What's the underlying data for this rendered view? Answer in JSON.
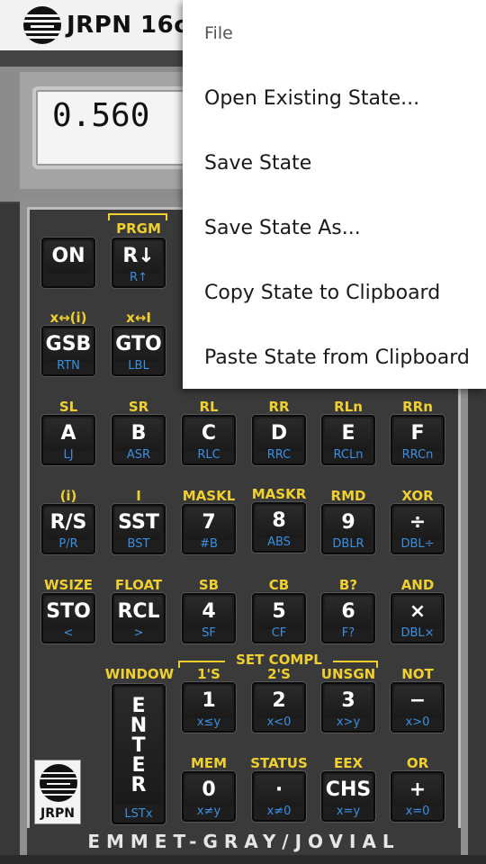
{
  "app": {
    "title": "JRPN 16c"
  },
  "display": {
    "value": "0.560"
  },
  "menu": {
    "header": "File",
    "items": [
      "Open Existing State...",
      "Save State",
      "Save State As...",
      "Copy State to Clipboard",
      "Paste State from Clipboard"
    ]
  },
  "keyboard": {
    "brand": "EMMET-GRAY/JOVIAL",
    "badge": "JRPN",
    "bracket_label": "SET COMPL",
    "top_labels": {
      "prgm": "PRGM",
      "x_swap_i": "x↔(i)",
      "x_swap_I": "x↔I",
      "sl": "SL",
      "sr": "SR",
      "rl": "RL",
      "rr": "RR",
      "rln": "RLn",
      "rrn": "RRn",
      "i_paren": "(i)",
      "i": "I",
      "maskl": "MASKL",
      "maskr": "MASKR",
      "rmd": "RMD",
      "xor": "XOR",
      "wsize": "WSIZE",
      "float": "FLOAT",
      "sb": "SB",
      "cb": "CB",
      "bq": "B?",
      "and": "AND",
      "window": "WINDOW",
      "c1s": "1'S",
      "c2s": "2'S",
      "unsgn": "UNSGN",
      "not": "NOT",
      "mem": "MEM",
      "status": "STATUS",
      "eex": "EEX",
      "or": "OR"
    },
    "keys": {
      "on": {
        "main": "ON",
        "sub": ""
      },
      "rdown": {
        "main": "R↓",
        "sub": "R↑"
      },
      "gsb": {
        "main": "GSB",
        "sub": "RTN"
      },
      "gto": {
        "main": "GTO",
        "sub": "LBL"
      },
      "a": {
        "main": "A",
        "sub": "LJ"
      },
      "b": {
        "main": "B",
        "sub": "ASR"
      },
      "c": {
        "main": "C",
        "sub": "RLC"
      },
      "d": {
        "main": "D",
        "sub": "RRC"
      },
      "e": {
        "main": "E",
        "sub": "RCLn"
      },
      "f": {
        "main": "F",
        "sub": "RRCn"
      },
      "rs": {
        "main": "R/S",
        "sub": "P/R"
      },
      "sst": {
        "main": "SST",
        "sub": "BST"
      },
      "k7": {
        "main": "7",
        "sub": "#B"
      },
      "k8": {
        "main": "8",
        "sub": "ABS"
      },
      "k9": {
        "main": "9",
        "sub": "DBLR"
      },
      "div": {
        "main": "÷",
        "sub": "DBL÷"
      },
      "sto": {
        "main": "STO",
        "sub": "<"
      },
      "rcl": {
        "main": "RCL",
        "sub": ">"
      },
      "k4": {
        "main": "4",
        "sub": "SF"
      },
      "k5": {
        "main": "5",
        "sub": "CF"
      },
      "k6": {
        "main": "6",
        "sub": "F?"
      },
      "mul": {
        "main": "×",
        "sub": "DBL×"
      },
      "enter": {
        "main": "ENTER",
        "sub": "LSTx"
      },
      "k1": {
        "main": "1",
        "sub": "x≤y"
      },
      "k2": {
        "main": "2",
        "sub": "x<0"
      },
      "k3": {
        "main": "3",
        "sub": "x>y"
      },
      "sub": {
        "main": "−",
        "sub": "x>0"
      },
      "k0": {
        "main": "0",
        "sub": "x≠y"
      },
      "dot": {
        "main": "·",
        "sub": "x≠0"
      },
      "chs": {
        "main": "CHS",
        "sub": "x=y"
      },
      "add": {
        "main": "+",
        "sub": "x=0"
      }
    }
  }
}
